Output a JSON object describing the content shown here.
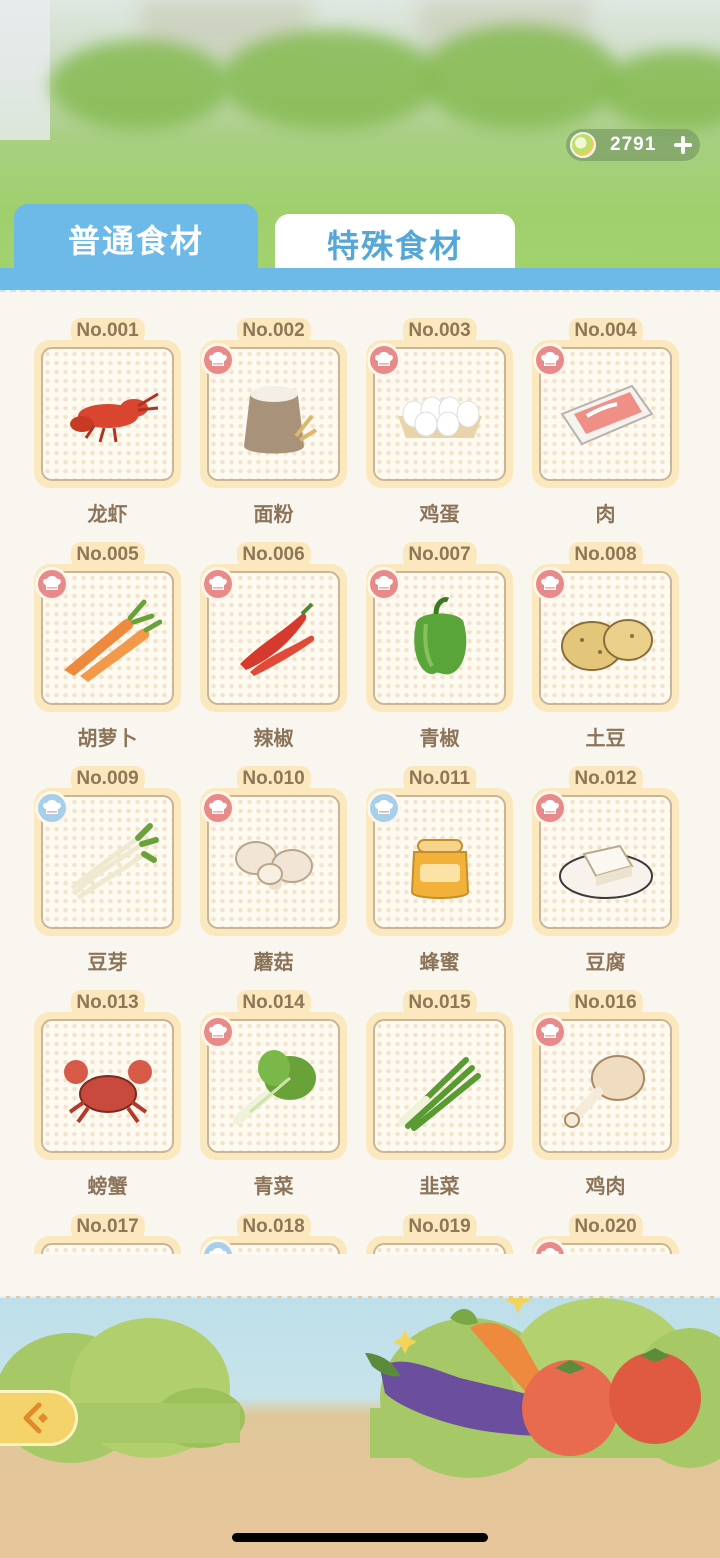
{
  "currency": {
    "value": "2791",
    "icon": "leaf-coin-icon",
    "add_icon": "plus-icon"
  },
  "tabs": [
    {
      "label": "普通食材",
      "active": true
    },
    {
      "label": "特殊食材",
      "active": false
    }
  ],
  "ingredients": [
    {
      "num": "No.001",
      "name": "龙虾",
      "icon": "lobster-icon",
      "badge": "none"
    },
    {
      "num": "No.002",
      "name": "面粉",
      "icon": "flour-sack-icon",
      "badge": "red"
    },
    {
      "num": "No.003",
      "name": "鸡蛋",
      "icon": "eggs-icon",
      "badge": "red"
    },
    {
      "num": "No.004",
      "name": "肉",
      "icon": "meat-tray-icon",
      "badge": "red"
    },
    {
      "num": "No.005",
      "name": "胡萝卜",
      "icon": "carrot-icon",
      "badge": "red"
    },
    {
      "num": "No.006",
      "name": "辣椒",
      "icon": "chili-icon",
      "badge": "red"
    },
    {
      "num": "No.007",
      "name": "青椒",
      "icon": "green-pepper-icon",
      "badge": "red"
    },
    {
      "num": "No.008",
      "name": "土豆",
      "icon": "potato-icon",
      "badge": "red"
    },
    {
      "num": "No.009",
      "name": "豆芽",
      "icon": "bean-sprout-icon",
      "badge": "blue"
    },
    {
      "num": "No.010",
      "name": "蘑菇",
      "icon": "mushroom-icon",
      "badge": "red"
    },
    {
      "num": "No.011",
      "name": "蜂蜜",
      "icon": "honey-jar-icon",
      "badge": "blue"
    },
    {
      "num": "No.012",
      "name": "豆腐",
      "icon": "tofu-icon",
      "badge": "red"
    },
    {
      "num": "No.013",
      "name": "螃蟹",
      "icon": "crab-icon",
      "badge": "none"
    },
    {
      "num": "No.014",
      "name": "青菜",
      "icon": "bok-choy-icon",
      "badge": "red"
    },
    {
      "num": "No.015",
      "name": "韭菜",
      "icon": "chives-icon",
      "badge": "none"
    },
    {
      "num": "No.016",
      "name": "鸡肉",
      "icon": "drumstick-icon",
      "badge": "red"
    },
    {
      "num": "No.017",
      "name": "",
      "icon": "",
      "badge": "none"
    },
    {
      "num": "No.018",
      "name": "",
      "icon": "",
      "badge": "blue"
    },
    {
      "num": "No.019",
      "name": "",
      "icon": "",
      "badge": "none"
    },
    {
      "num": "No.020",
      "name": "",
      "icon": "",
      "badge": "red"
    }
  ],
  "back_button": {
    "icon": "back-arrow-icon"
  },
  "colors": {
    "tab_blue": "#6db9e8",
    "card_frame": "#fbe8be",
    "badge_red": "#e98a8a",
    "badge_blue": "#a7cfe9",
    "label_brown": "#8b7459"
  }
}
